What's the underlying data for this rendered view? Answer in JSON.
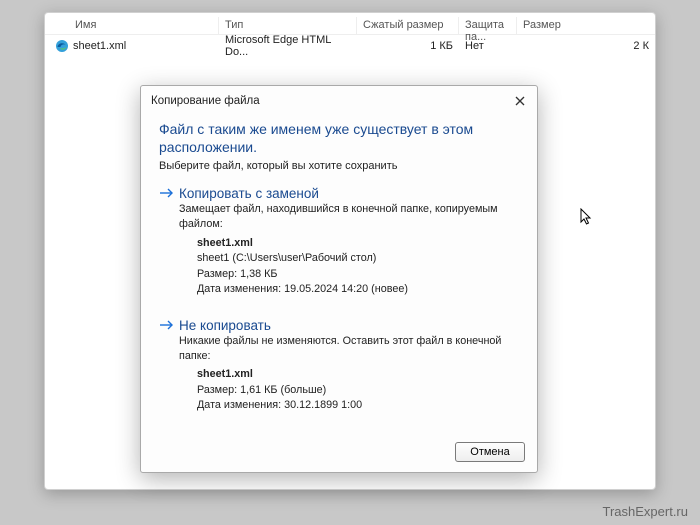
{
  "columns": {
    "name": "Имя",
    "type": "Тип",
    "compressed": "Сжатый размер",
    "protection": "Защита па...",
    "size": "Размер"
  },
  "row": {
    "name": "sheet1.xml",
    "type": "Microsoft Edge HTML Do...",
    "compressed": "1 КБ",
    "protection": "Нет",
    "size": "2 К"
  },
  "dialog": {
    "title": "Копирование файла",
    "heading": "Файл с таким же именем уже существует в этом расположении.",
    "instruction": "Выберите файл, который вы хотите сохранить",
    "option1": {
      "title": "Копировать с заменой",
      "desc": "Замещает файл, находившийся в конечной папке, копируемым файлом:",
      "filename": "sheet1.xml",
      "path": "sheet1 (C:\\Users\\user\\Рабочий стол)",
      "size": "Размер: 1,38 КБ",
      "modified": "Дата изменения: 19.05.2024 14:20 (новее)"
    },
    "option2": {
      "title": "Не копировать",
      "desc": "Никакие файлы не изменяются. Оставить этот файл в конечной папке:",
      "filename": "sheet1.xml",
      "size": "Размер: 1,61 КБ (больше)",
      "modified": "Дата изменения: 30.12.1899 1:00"
    },
    "cancel": "Отмена"
  },
  "watermark": "TrashExpert.ru"
}
